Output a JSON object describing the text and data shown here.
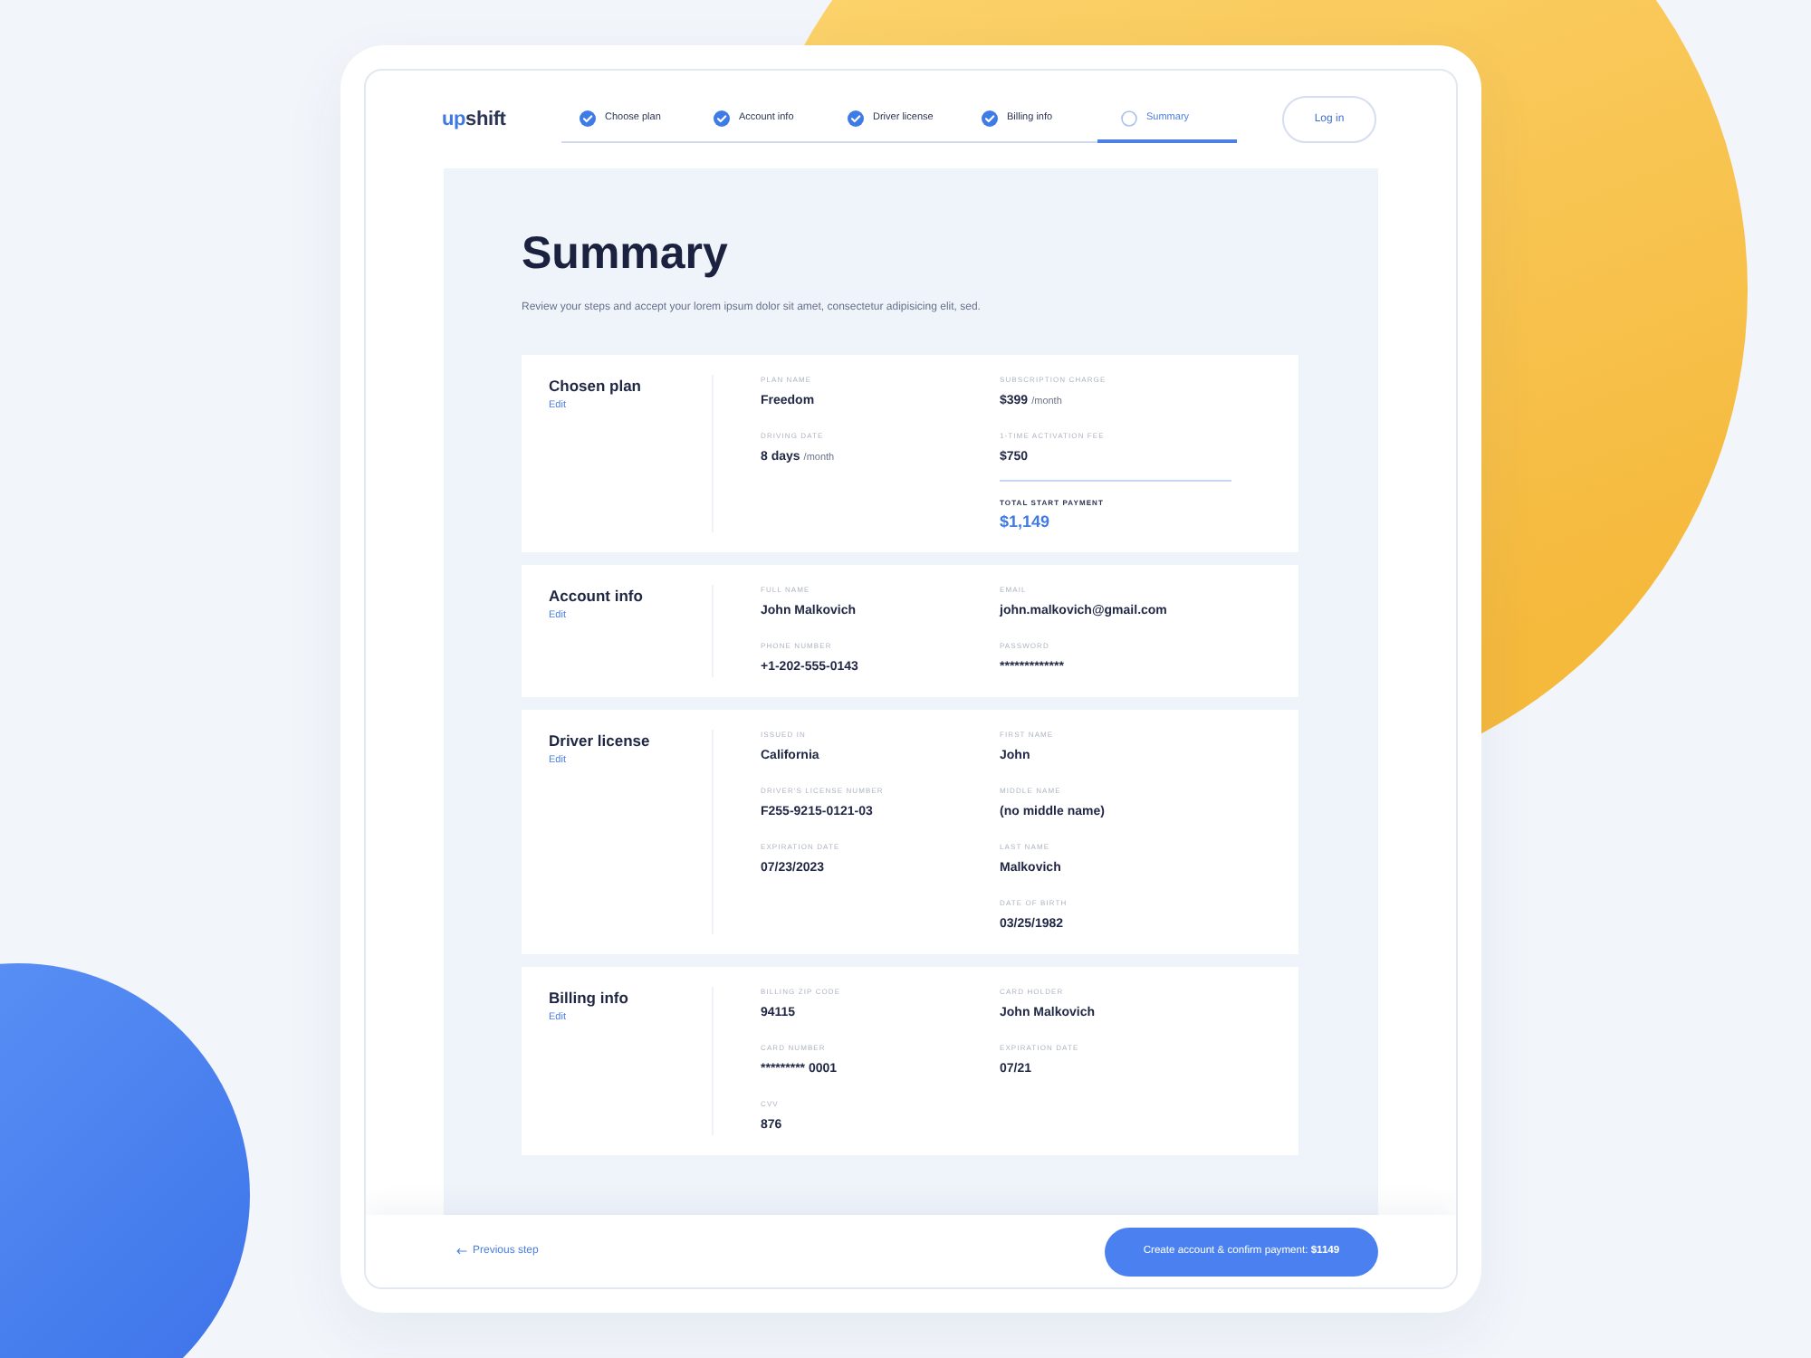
{
  "header": {
    "logo": [
      {
        "text": "up",
        "accent": true
      },
      {
        "text": "shift",
        "accent": false
      }
    ],
    "steps": [
      {
        "label": "Choose plan",
        "done": true,
        "selected": false
      },
      {
        "label": "Account info",
        "done": true,
        "selected": false
      },
      {
        "label": "Driver license",
        "done": true,
        "selected": false
      },
      {
        "label": "Billing info",
        "done": true,
        "selected": false
      },
      {
        "label": "Summary",
        "done": false,
        "selected": true
      }
    ],
    "login_button": "Log in"
  },
  "summary": {
    "title": "Summary",
    "subtitle": "Review your steps and accept your lorem ipsum dolor sit amet, consectetur adipisicing elit, sed.",
    "sections": [
      {
        "title": "Chosen plan",
        "edit_link": "Edit",
        "columns": [
          [
            {
              "kind": "field",
              "label": "PLAN NAME",
              "value": "Freedom"
            },
            {
              "kind": "field",
              "label": "DRIVING DATE",
              "value": "8 days",
              "unit": "/month"
            }
          ],
          [
            {
              "kind": "field",
              "label": "SUBSCRIPTION CHARGE",
              "value": "$399",
              "unit": "/month"
            },
            {
              "kind": "field",
              "label": "1-TIME ACTIVATION FEE",
              "value": "$750"
            },
            {
              "kind": "total",
              "label": "TOTAL START PAYMENT",
              "value": "$1,149"
            }
          ]
        ]
      },
      {
        "title": "Account info",
        "edit_link": "Edit",
        "columns": [
          [
            {
              "kind": "field",
              "label": "FULL NAME",
              "value": "John Malkovich"
            },
            {
              "kind": "field",
              "label": "PHONE NUMBER",
              "value": "+1-202-555-0143"
            }
          ],
          [
            {
              "kind": "field",
              "label": "EMAIL",
              "value": "john.malkovich@gmail.com"
            },
            {
              "kind": "field",
              "label": "PASSWORD",
              "value": "*************"
            }
          ]
        ]
      },
      {
        "title": "Driver license",
        "edit_link": "Edit",
        "columns": [
          [
            {
              "kind": "field",
              "label": "ISSUED IN",
              "value": "California"
            },
            {
              "kind": "field",
              "label": "DRIVER'S LICENSE NUMBER",
              "value": "F255-9215-0121-03"
            },
            {
              "kind": "field",
              "label": "EXPIRATION DATE",
              "value": "07/23/2023"
            }
          ],
          [
            {
              "kind": "field",
              "label": "FIRST NAME",
              "value": "John"
            },
            {
              "kind": "field",
              "label": "MIDDLE NAME",
              "value": "(no middle name)"
            },
            {
              "kind": "field",
              "label": "LAST NAME",
              "value": "Malkovich"
            },
            {
              "kind": "field",
              "label": "DATE OF BIRTH",
              "value": "03/25/1982"
            }
          ]
        ]
      },
      {
        "title": "Billing info",
        "edit_link": "Edit",
        "columns": [
          [
            {
              "kind": "field",
              "label": "BILLING ZIP CODE",
              "value": "94115"
            },
            {
              "kind": "field",
              "label": "CARD NUMBER",
              "value": "********* 0001"
            },
            {
              "kind": "field",
              "label": "CVV",
              "value": "876"
            }
          ],
          [
            {
              "kind": "field",
              "label": "CARD HOLDER",
              "value": "John Malkovich"
            },
            {
              "kind": "field",
              "label": "EXPIRATION DATE",
              "value": "07/21"
            }
          ]
        ]
      }
    ]
  },
  "footer": {
    "back_link": "Previous step",
    "confirm_button": "Create account & confirm payment: **$1149**"
  }
}
